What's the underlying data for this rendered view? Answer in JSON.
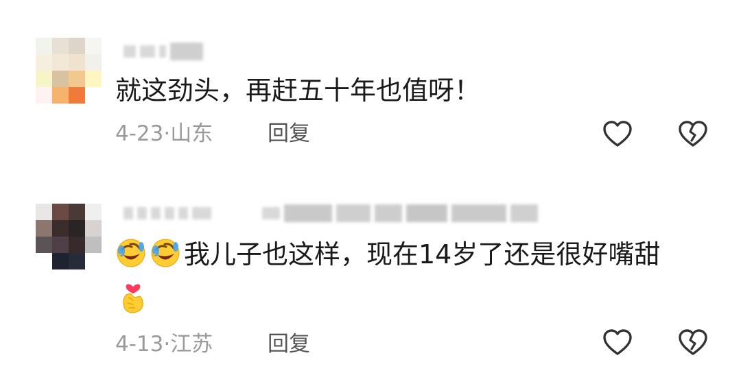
{
  "comments": [
    {
      "avatar_icon": "pixelated-avatar",
      "username": "",
      "text": "就这劲头，再赶五十年也值呀！",
      "date": "4-23",
      "separator": "·",
      "location": "山东",
      "reply_label": "回复",
      "like_icon": "heart-outline-icon",
      "dislike_icon": "broken-heart-icon"
    },
    {
      "avatar_icon": "pixelated-avatar",
      "username": "",
      "text": "我儿子也这样，现在14岁了还是很好嘴甜",
      "emoji_inline": [
        "rolling-laughing-emoji",
        "rolling-laughing-emoji"
      ],
      "emoji_trailing": "finger-heart-emoji",
      "date": "4-13",
      "separator": "·",
      "location": "江苏",
      "reply_label": "回复",
      "like_icon": "heart-outline-icon",
      "dislike_icon": "broken-heart-icon"
    }
  ],
  "colors": {
    "text": "#1a1a1a",
    "meta": "#9a9a9a",
    "reply": "#555555",
    "icon": "#333333"
  }
}
